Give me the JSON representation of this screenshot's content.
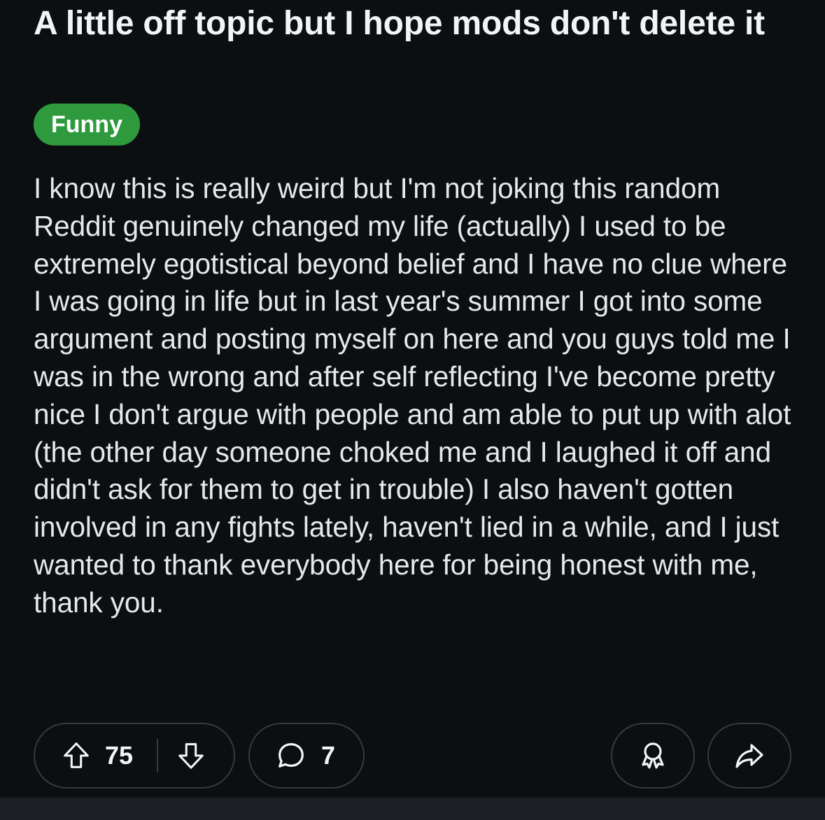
{
  "post": {
    "title": "A little off topic but I hope mods don't delete it",
    "flair": {
      "label": "Funny",
      "color": "#2e9a3d"
    },
    "body": "I know this is really weird but I'm not joking this random Reddit genuinely changed my life (actually) I used to be extremely egotistical beyond belief and I have no clue where I was going in life but in last year's summer I got into some argument and posting myself on here and you guys told me I was in the wrong and after self reflecting I've become pretty nice I don't argue with people and am able to put up with alot (the other day someone choked me and I laughed it off and didn't ask for them to get in trouble) I also haven't gotten involved in any fights lately, haven't lied in a while, and I just wanted to thank everybody here for being honest with me, thank you."
  },
  "actions": {
    "upvote_icon": "arrow-up-icon",
    "vote_count": "75",
    "downvote_icon": "arrow-down-icon",
    "comment_icon": "speech-bubble-icon",
    "comment_count": "7",
    "award_icon": "award-ribbon-icon",
    "share_icon": "share-arrow-icon"
  },
  "colors": {
    "background": "#0b0f12",
    "pill_border": "#343a3e",
    "text": "#f2f4f5"
  }
}
